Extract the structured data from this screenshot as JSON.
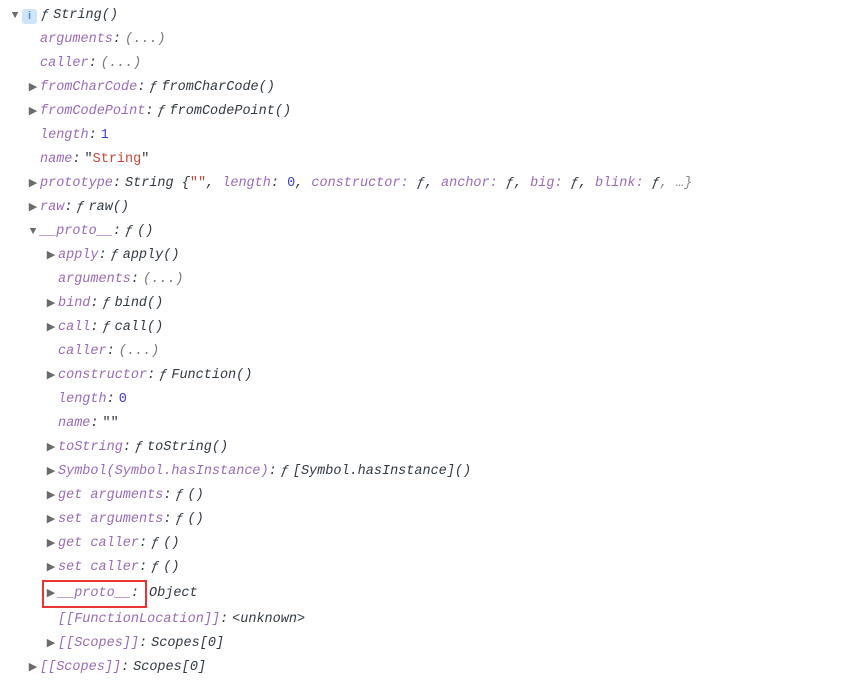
{
  "root": {
    "header": "String()"
  },
  "lvl1": {
    "arguments": {
      "key": "arguments",
      "val": "(...)"
    },
    "caller": {
      "key": "caller",
      "val": "(...)"
    },
    "fromCharCode": {
      "key": "fromCharCode",
      "val": "fromCharCode()"
    },
    "fromCodePoint": {
      "key": "fromCodePoint",
      "val": "fromCodePoint()"
    },
    "length": {
      "key": "length",
      "val": "1"
    },
    "name": {
      "key": "name",
      "val": "String"
    },
    "prototype": {
      "key": "prototype",
      "lead": "String {",
      "str": "\"\"",
      "seg_len_k": "length",
      "seg_len_v": "0",
      "seg_ctor": "constructor: ",
      "seg_anchor": "anchor: ",
      "seg_big": "big: ",
      "seg_blink": "blink: ",
      "f": "ƒ",
      "close": ", …}"
    },
    "raw": {
      "key": "raw",
      "val": "raw()"
    },
    "proto": {
      "key": "__proto__",
      "val": "()"
    },
    "scopes": {
      "key": "[[Scopes]]",
      "val": "Scopes[0]"
    }
  },
  "lvl2": {
    "apply": {
      "key": "apply",
      "val": "apply()"
    },
    "arguments": {
      "key": "arguments",
      "val": "(...)"
    },
    "bind": {
      "key": "bind",
      "val": "bind()"
    },
    "call": {
      "key": "call",
      "val": "call()"
    },
    "caller": {
      "key": "caller",
      "val": "(...)"
    },
    "constructor": {
      "key": "constructor",
      "val": "Function()"
    },
    "length": {
      "key": "length",
      "val": "0"
    },
    "name": {
      "key": "name",
      "val": ""
    },
    "toString": {
      "key": "toString",
      "val": "toString()"
    },
    "symbolHasInstance": {
      "key": "Symbol(Symbol.hasInstance)",
      "val": "[Symbol.hasInstance]()"
    },
    "getArguments": {
      "key": "get arguments",
      "val": "()"
    },
    "setArguments": {
      "key": "set arguments",
      "val": "()"
    },
    "getCaller": {
      "key": "get caller",
      "val": "()"
    },
    "setCaller": {
      "key": "set caller",
      "val": "()"
    },
    "proto": {
      "key": "__proto__",
      "val": "Object"
    },
    "functionLocation": {
      "key": "[[FunctionLocation]]",
      "val": "<unknown>"
    },
    "scopes": {
      "key": "[[Scopes]]",
      "val": "Scopes[0]"
    }
  },
  "glyph": {
    "f": "ƒ ",
    "fsolo": "ƒ "
  }
}
